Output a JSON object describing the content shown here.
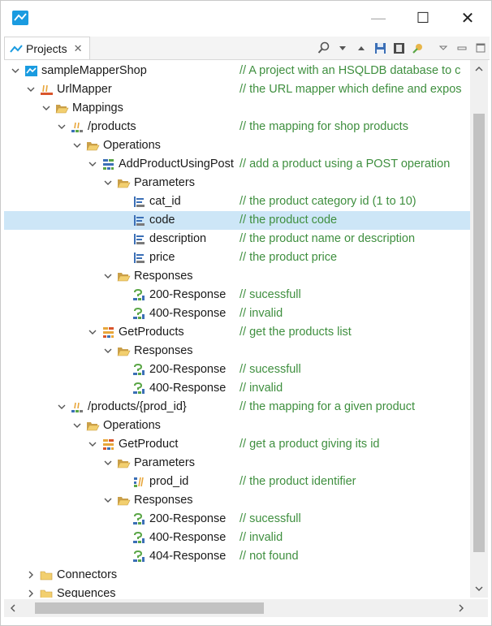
{
  "window": {
    "minimize_symbol": "—",
    "maximize_symbol": "☐",
    "close_symbol": "✕"
  },
  "view_tab": {
    "label": "Projects",
    "close_symbol": "✕"
  },
  "toolbar_icons": [
    "search-icon",
    "dropdown-arrow-icon",
    "collapse-up-icon",
    "save-icon",
    "save-copy-icon",
    "wizard-icon",
    "view-menu-icon",
    "minimize-view-icon",
    "maximize-view-icon"
  ],
  "colors": {
    "comment": "#3f8f3f",
    "selection": "#cde6f7",
    "folder": "#e8b64a",
    "project": "#1a9be0"
  },
  "tree": [
    {
      "label": "sampleMapperShop",
      "comment": "// A project with an HSQLDB database to c",
      "icon": "project-icon",
      "twisty": "expanded"
    },
    {
      "label": "UrlMapper",
      "comment": "// the URL mapper which define and expos",
      "icon": "url-mapper-icon",
      "twisty": "expanded"
    },
    {
      "label": "Mappings",
      "comment": "",
      "icon": "folder-open-icon",
      "twisty": "expanded"
    },
    {
      "label": "/products",
      "comment": "// the mapping for shop products",
      "icon": "mapping-path-icon",
      "twisty": "expanded"
    },
    {
      "label": "Operations",
      "comment": "",
      "icon": "folder-open-icon",
      "twisty": "expanded"
    },
    {
      "label": "AddProductUsingPost",
      "comment": "// add a product using a POST operation",
      "icon": "post-operation-icon",
      "twisty": "expanded"
    },
    {
      "label": "Parameters",
      "comment": "",
      "icon": "folder-open-icon",
      "twisty": "expanded"
    },
    {
      "label": "cat_id",
      "comment": "// the product category id (1 to 10)",
      "icon": "form-parameter-icon",
      "twisty": "none"
    },
    {
      "label": "code",
      "comment": "// the product code",
      "icon": "form-parameter-icon",
      "twisty": "none",
      "selected": true
    },
    {
      "label": "description",
      "comment": "// the product name or description",
      "icon": "form-parameter-icon",
      "twisty": "none"
    },
    {
      "label": "price",
      "comment": "// the product price",
      "icon": "form-parameter-icon",
      "twisty": "none"
    },
    {
      "label": "Responses",
      "comment": "",
      "icon": "folder-open-icon",
      "twisty": "expanded"
    },
    {
      "label": "200-Response",
      "comment": "// sucessfull",
      "icon": "response-icon",
      "twisty": "none"
    },
    {
      "label": "400-Response",
      "comment": "// invalid",
      "icon": "response-icon",
      "twisty": "none"
    },
    {
      "label": "GetProducts",
      "comment": "// get the products list",
      "icon": "get-operation-icon",
      "twisty": "expanded"
    },
    {
      "label": "Responses",
      "comment": "",
      "icon": "folder-open-icon",
      "twisty": "expanded"
    },
    {
      "label": "200-Response",
      "comment": "// sucessfull",
      "icon": "response-icon",
      "twisty": "none"
    },
    {
      "label": "400-Response",
      "comment": "// invalid",
      "icon": "response-icon",
      "twisty": "none"
    },
    {
      "label": "/products/{prod_id}",
      "comment": "// the mapping for a given product",
      "icon": "mapping-path-icon",
      "twisty": "expanded"
    },
    {
      "label": "Operations",
      "comment": "",
      "icon": "folder-open-icon",
      "twisty": "expanded"
    },
    {
      "label": "GetProduct",
      "comment": "// get a product giving its id",
      "icon": "get-operation-icon",
      "twisty": "expanded"
    },
    {
      "label": "Parameters",
      "comment": "",
      "icon": "folder-open-icon",
      "twisty": "expanded"
    },
    {
      "label": "prod_id",
      "comment": "// the product identifier",
      "icon": "path-parameter-icon",
      "twisty": "none"
    },
    {
      "label": "Responses",
      "comment": "",
      "icon": "folder-open-icon",
      "twisty": "expanded"
    },
    {
      "label": "200-Response",
      "comment": "// sucessfull",
      "icon": "response-icon",
      "twisty": "none"
    },
    {
      "label": "400-Response",
      "comment": "// invalid",
      "icon": "response-icon",
      "twisty": "none"
    },
    {
      "label": "404-Response",
      "comment": "// not found",
      "icon": "response-icon",
      "twisty": "none"
    },
    {
      "label": "Connectors",
      "comment": "",
      "icon": "folder-closed-icon",
      "twisty": "collapsed"
    },
    {
      "label": "Sequences",
      "comment": "",
      "icon": "folder-closed-icon",
      "twisty": "collapsed"
    }
  ]
}
